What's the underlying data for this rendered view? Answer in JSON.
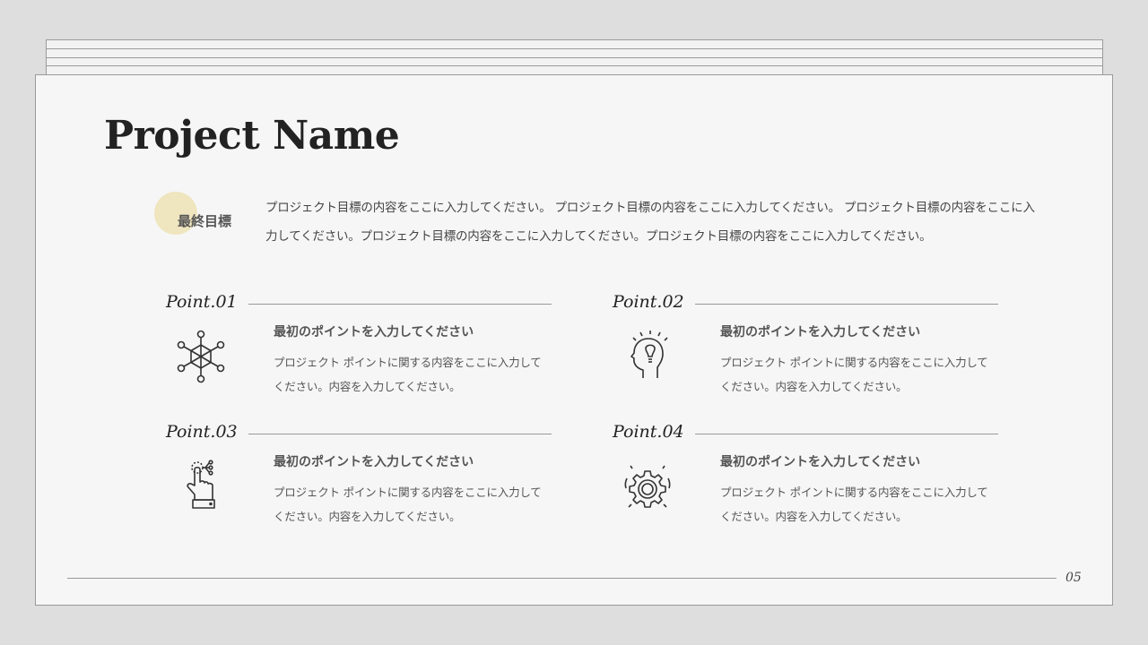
{
  "slide": {
    "title": "Project Name",
    "goal_label": "最終目標",
    "goal_text": "プロジェクト目標の内容をここに入力してください。 プロジェクト目標の内容をここに入力してください。 プロジェクト目標の内容をここに入力してください。プロジェクト目標の内容をここに入力してください。プロジェクト目標の内容をここに入力してください。",
    "page_number": "05",
    "accent_color": "#ede3b8",
    "points": [
      {
        "label": "Point.01",
        "heading": "最初のポイントを入力してください",
        "body": "プロジェクト ポイントに関する内容をここに入力してください。内容を入力してください。",
        "icon": "molecule-network-icon"
      },
      {
        "label": "Point.02",
        "heading": "最初のポイントを入力してください",
        "body": "プロジェクト ポイントに関する内容をここに入力してください。内容を入力してください。",
        "icon": "head-lightbulb-icon"
      },
      {
        "label": "Point.03",
        "heading": "最初のポイントを入力してください",
        "body": "プロジェクト ポイントに関する内容をここに入力してください。内容を入力してください。",
        "icon": "touch-hand-icon"
      },
      {
        "label": "Point.04",
        "heading": "最初のポイントを入力してください",
        "body": "プロジェクト ポイントに関する内容をここに入力してください。内容を入力してください。",
        "icon": "gear-icon"
      }
    ]
  }
}
